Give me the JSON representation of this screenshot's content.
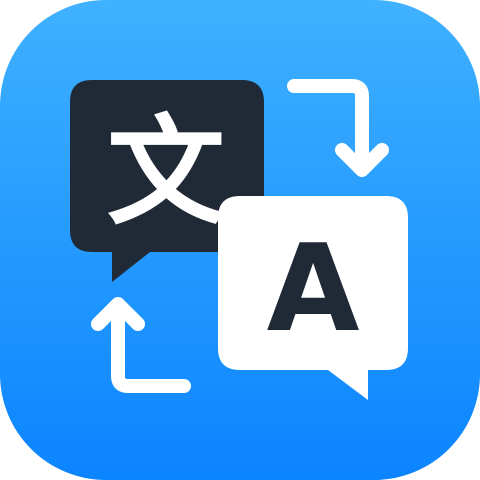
{
  "icon": {
    "source_glyph": "文",
    "target_glyph": "A",
    "icon_name": "translate-app-icon",
    "colors": {
      "background_top": "#3fb1ff",
      "background_bottom": "#0b84ff",
      "dark_bubble": "#202a37",
      "light_bubble": "#ffffff",
      "arrow": "#ffffff"
    }
  }
}
